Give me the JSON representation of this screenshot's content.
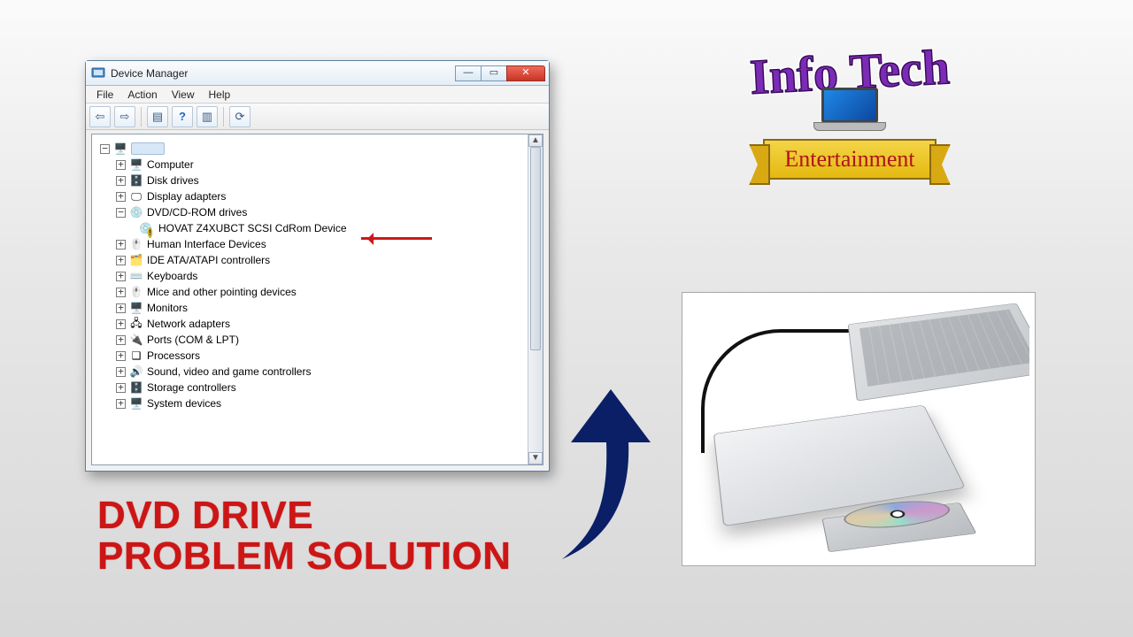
{
  "window": {
    "title": "Device Manager",
    "min_label": "—",
    "max_label": "▭",
    "close_label": "✕"
  },
  "menu": {
    "file": "File",
    "action": "Action",
    "view": "View",
    "help": "Help"
  },
  "toolbar": {
    "back": "⇦",
    "forward": "⇨",
    "show": "▤",
    "help": "?",
    "props": "▥",
    "scan": "⟳"
  },
  "tree": {
    "root": "",
    "items": [
      {
        "label": "Computer",
        "icon": "🖥️"
      },
      {
        "label": "Disk drives",
        "icon": "🗄️"
      },
      {
        "label": "Display adapters",
        "icon": "🖵"
      },
      {
        "label": "DVD/CD-ROM drives",
        "icon": "💿",
        "expanded": true,
        "child": {
          "label": "HOVAT Z4XUBCT SCSI CdRom Device",
          "icon": "💿"
        }
      },
      {
        "label": "Human Interface Devices",
        "icon": "🖱️"
      },
      {
        "label": "IDE ATA/ATAPI controllers",
        "icon": "🗂️"
      },
      {
        "label": "Keyboards",
        "icon": "⌨️"
      },
      {
        "label": "Mice and other pointing devices",
        "icon": "🖱️"
      },
      {
        "label": "Monitors",
        "icon": "🖥️"
      },
      {
        "label": "Network adapters",
        "icon": "🖧"
      },
      {
        "label": "Ports (COM & LPT)",
        "icon": "🔌"
      },
      {
        "label": "Processors",
        "icon": "❑"
      },
      {
        "label": "Sound, video and game controllers",
        "icon": "🔊"
      },
      {
        "label": "Storage controllers",
        "icon": "🗄️"
      },
      {
        "label": "System devices",
        "icon": "🖥️"
      }
    ]
  },
  "headline": {
    "line1": "DVD DRIVE",
    "line2": "PROBLEM SOLUTION"
  },
  "logo": {
    "title": "Info Tech",
    "subtitle": "Entertainment"
  }
}
